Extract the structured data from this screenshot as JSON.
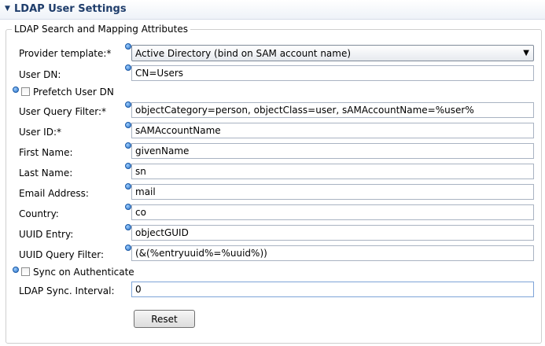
{
  "section": {
    "title": "LDAP User Settings"
  },
  "group": {
    "title": "LDAP Search and Mapping Attributes"
  },
  "provider_template": {
    "label": "Provider template:*",
    "selected": "Active Directory (bind on SAM account name)"
  },
  "user_dn": {
    "label": "User DN:",
    "value": "CN=Users"
  },
  "prefetch_user_dn": {
    "label": "Prefetch User DN",
    "checked": false
  },
  "user_query_filter": {
    "label": "User Query Filter:*",
    "value": "objectCategory=person, objectClass=user, sAMAccountName=%user%"
  },
  "user_id": {
    "label": "User ID:*",
    "value": "sAMAccountName"
  },
  "first_name": {
    "label": "First Name:",
    "value": "givenName"
  },
  "last_name": {
    "label": "Last Name:",
    "value": "sn"
  },
  "email_address": {
    "label": "Email Address:",
    "value": "mail"
  },
  "country": {
    "label": "Country:",
    "value": "co"
  },
  "uuid_entry": {
    "label": "UUID Entry:",
    "value": "objectGUID"
  },
  "uuid_query_filter": {
    "label": "UUID Query Filter:",
    "value": "(&(%entryuuid%=%uuid%))"
  },
  "sync_on_authenticate": {
    "label": "Sync on Authenticate",
    "checked": false
  },
  "ldap_sync_interval": {
    "label": "LDAP Sync. Interval:",
    "value": "0"
  },
  "reset_button": {
    "label": "Reset"
  },
  "colors": {
    "header_title": "#1f3d6b",
    "info_icon": "#2a6fc4",
    "field_border": "#a9b3c2"
  }
}
